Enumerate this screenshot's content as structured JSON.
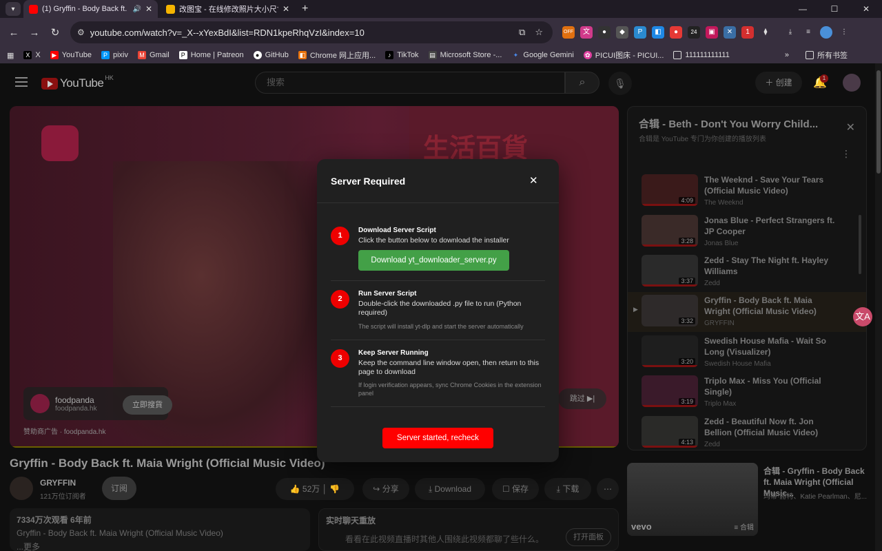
{
  "browser": {
    "tabs": [
      {
        "title": "(1) Gryffin - Body Back ft. Maia",
        "active": true
      },
      {
        "title": "改图宝 - 在线修改照片大小尺寸",
        "active": false
      }
    ],
    "url": "youtube.com/watch?v=_X--xYexBdI&list=RDN1kpeRhqVzI&index=10",
    "bookmarks": [
      "X",
      "YouTube",
      "pixiv",
      "Gmail",
      "Home | Patreon",
      "GitHub",
      "Chrome 网上应用...",
      "TikTok",
      "Microsoft Store -...",
      "Google Gemini",
      "PICUI图床 - PICUI...",
      "111111111111"
    ],
    "all_bookmarks": "所有书签",
    "extension_badges": {
      "off": "OFF",
      "count": "24",
      "one": "1"
    }
  },
  "youtube": {
    "logo": "YouTube",
    "region": "HK",
    "search_placeholder": "搜索",
    "create": "创建",
    "notification_count": "1",
    "ad": {
      "headline": "生活百貨",
      "brand": "foodpanda",
      "brand_url": "foodpanda.hk",
      "cta": "立即搜貨",
      "sponsor": "赞助商广告 · foodpanda.hk",
      "skip": "跳过"
    },
    "video_title": "Gryffin - Body Back ft. Maia Wright (Official Music Video)",
    "channel": {
      "name": "GRYFFIN",
      "subs": "121万位订阅者",
      "subscribe": "订阅"
    },
    "actions": {
      "likes": "52万",
      "share": "分享",
      "download": "Download",
      "save": "保存",
      "dl_cn": "下载"
    },
    "description": {
      "stats": "7334万次观看  6年前",
      "line": "Gryffin - Body Back ft. Maia Wright (Official Music Video)",
      "more": "...更多"
    },
    "chat": {
      "title": "实时聊天重放",
      "desc": "看看在此视频直播时其他人围绕此视频都聊了些什么。",
      "open": "打开面板"
    },
    "playlist": {
      "title": "合辑 - Beth - Don't You Worry Child...",
      "subtitle": "合辑是 YouTube 专门为你创建的播放列表",
      "items": [
        {
          "title": "The Weeknd - Save Your Tears (Official Music Video)",
          "artist": "The Weeknd",
          "dur": "4:09"
        },
        {
          "title": "Jonas Blue - Perfect Strangers ft. JP Cooper",
          "artist": "Jonas Blue",
          "dur": "3:28"
        },
        {
          "title": "Zedd - Stay The Night ft. Hayley Williams",
          "artist": "Zedd",
          "dur": "3:37"
        },
        {
          "title": "Gryffin - Body Back ft. Maia Wright (Official Music Video)",
          "artist": "GRYFFIN",
          "dur": "3:32"
        },
        {
          "title": "Swedish House Mafia - Wait So Long (Visualizer)",
          "artist": "Swedish House Mafia",
          "dur": "3:20"
        },
        {
          "title": "Triplo Max - Miss You (Official Single)",
          "artist": "Triplo Max",
          "dur": "3:19"
        },
        {
          "title": "Zedd - Beautiful Now ft. Jon Bellion (Official Music Video)",
          "artist": "Zedd",
          "dur": "4:13"
        }
      ]
    },
    "recommendation": {
      "title": "合辑 - Gryffin - Body Back ft. Maia Wright (Official Music...",
      "sub": "玛蒂·赫特、Katie Pearlman、尼...",
      "brand": "vevo",
      "mix": "合辑"
    },
    "translate_glyph": "文A"
  },
  "modal": {
    "title": "Server Required",
    "close": "✕",
    "steps": [
      {
        "num": "1",
        "title": "Download Server Script",
        "desc": "Click the button below to download the installer",
        "note": ""
      },
      {
        "num": "2",
        "title": "Run Server Script",
        "desc": "Double-click the downloaded .py file to run (Python required)",
        "note": "The script will install yt-dlp and start the server automatically"
      },
      {
        "num": "3",
        "title": "Keep Server Running",
        "desc": "Keep the command line window open, then return to this page to download",
        "note": "If login verification appears, sync Chrome Cookies in the extension panel"
      }
    ],
    "download_button": "Download yt_downloader_server.py",
    "recheck_button": "Server started, recheck"
  }
}
